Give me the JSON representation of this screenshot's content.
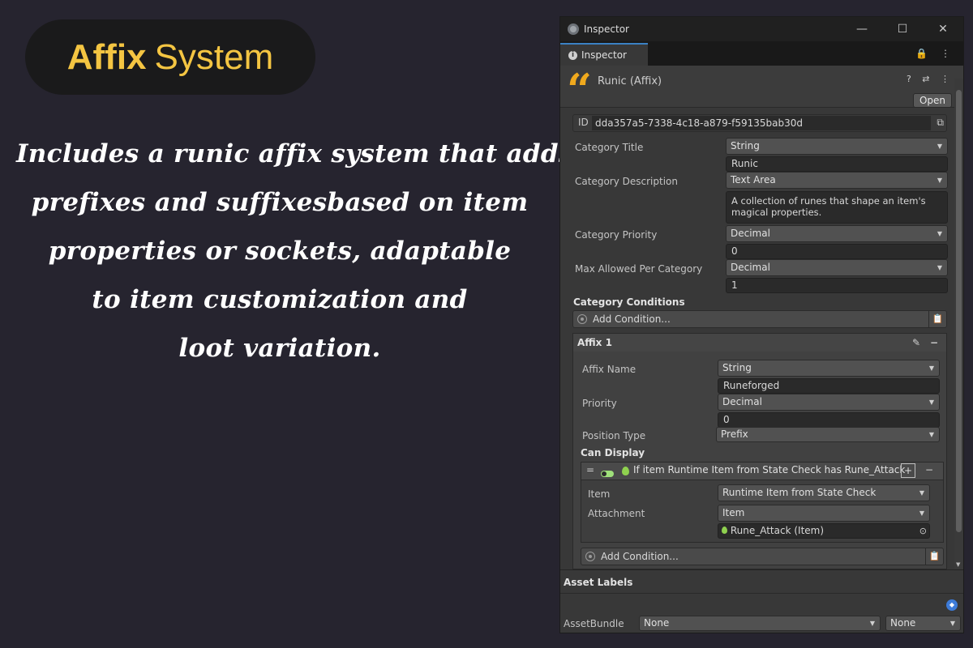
{
  "promo": {
    "title_bold": "Affix",
    "title_rest": "System",
    "lines": [
      "Includes a runic affix system that adds",
      "prefixes and suffixesbased on item",
      "properties or sockets, adaptable",
      "to item customization and",
      "loot variation."
    ]
  },
  "window": {
    "title": "Inspector",
    "controls": [
      "—",
      "☐",
      "✕"
    ],
    "tab_label": "Inspector",
    "tab_tools": "🔒 ⋮"
  },
  "header": {
    "quote_glyph": "“",
    "title": "Runic (Affix)",
    "icons": "? ⇄ ⋮",
    "open_button": "Open"
  },
  "fields": {
    "id_label": "ID",
    "id_value": "dda357a5-7338-4c18-a879-f59135bab30d",
    "category_title_label": "Category Title",
    "category_title_type": "String",
    "category_title_value": "Runic",
    "category_description_label": "Category Description",
    "category_description_type": "Text Area",
    "category_description_line1": "A collection of runes that shape an item's",
    "category_description_line2": "magical properties.",
    "category_priority_label": "Category Priority",
    "category_priority_type": "Decimal",
    "category_priority_value": "0",
    "max_allowed_label": "Max Allowed Per Category",
    "max_allowed_type": "Decimal",
    "max_allowed_value": "1",
    "category_conditions_heading": "Category Conditions",
    "add_condition_label": "Add Condition..."
  },
  "affix": {
    "header": "Affix 1",
    "name_label": "Affix Name",
    "name_type": "String",
    "name_value": "Runeforged",
    "priority_label": "Priority",
    "priority_type": "Decimal",
    "priority_value": "0",
    "position_label": "Position Type",
    "position_value": "Prefix",
    "can_display_heading": "Can Display",
    "condition_text": "If item Runtime Item from State Check has Rune_Attack",
    "item_label": "Item",
    "item_value": "Runtime Item from State Check",
    "attachment_label": "Attachment",
    "attachment_type": "Item",
    "attachment_value": "Rune_Attack (Item)",
    "add_condition_label": "Add Condition..."
  },
  "footer": {
    "asset_labels": "Asset Labels",
    "assetbundle_label": "AssetBundle",
    "assetbundle_value": "None",
    "variant_value": "None"
  },
  "colors": {
    "background": "#26242f",
    "accent_title": "#f4c542",
    "quote_icon": "#f0a91d",
    "tab_accent": "#3b82c4"
  }
}
